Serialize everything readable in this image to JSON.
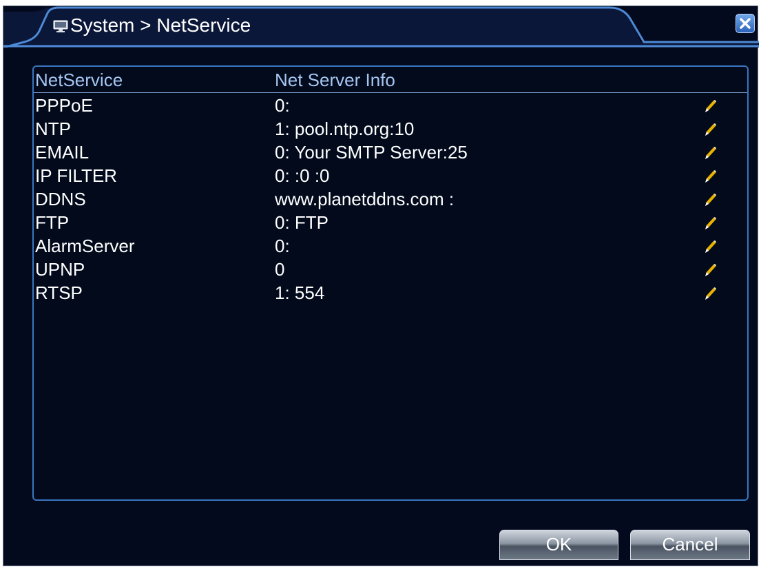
{
  "window": {
    "title": "System > NetService",
    "title_icon": "monitor-icon",
    "close_icon": "close-icon"
  },
  "table": {
    "headers": [
      "NetService",
      "Net Server Info"
    ],
    "rows": [
      {
        "service": "PPPoE",
        "info": "0:"
      },
      {
        "service": "NTP",
        "info": "1: pool.ntp.org:10"
      },
      {
        "service": "EMAIL",
        "info": "0: Your SMTP Server:25"
      },
      {
        "service": "IP FILTER",
        "info": "0: :0 :0"
      },
      {
        "service": "DDNS",
        "info": "www.planetddns.com :"
      },
      {
        "service": "FTP",
        "info": "0: FTP"
      },
      {
        "service": "AlarmServer",
        "info": "0:"
      },
      {
        "service": "UPNP",
        "info": "0"
      },
      {
        "service": "RTSP",
        "info": "1: 554"
      }
    ],
    "edit_icon": "pencil-icon"
  },
  "buttons": {
    "ok": "OK",
    "cancel": "Cancel"
  },
  "colors": {
    "background": "#040a1e",
    "accent": "#3a76c0",
    "header_text": "#a6c6f2",
    "text": "#ffffff"
  }
}
